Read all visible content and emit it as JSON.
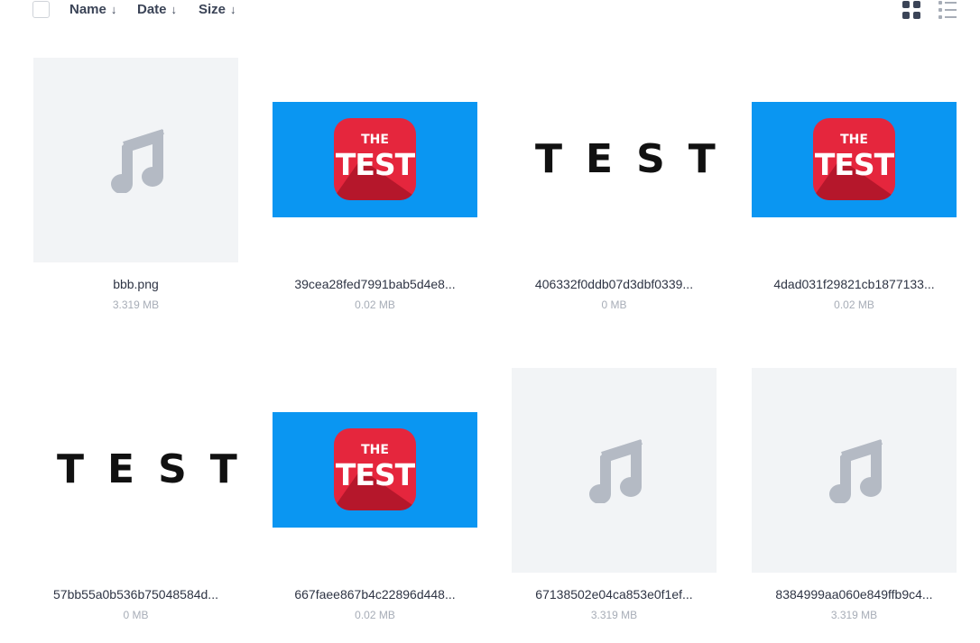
{
  "toolbar": {
    "sort_name": "Name",
    "sort_date": "Date",
    "sort_size": "Size",
    "arrow": "↓",
    "view_grid_icon": "grid-view-icon",
    "view_list_icon": "list-view-icon"
  },
  "colors": {
    "text_dark": "#2e3444",
    "text_muted": "#a7adb7",
    "placeholder_bg": "#f2f4f6",
    "music_icon": "#b4bac4",
    "thumb_blue": "#0a96f2",
    "logo_red": "#e5263d"
  },
  "files": [
    {
      "name": "bbb.png",
      "size": "3.319 MB",
      "thumb": "music"
    },
    {
      "name": "39cea28fed7991bab5d4e8...",
      "size": "0.02 MB",
      "thumb": "test-logo",
      "logo_top": "THE",
      "logo_bottom": "TEST"
    },
    {
      "name": "406332f0ddb07d3dbf0339...",
      "size": "0 MB",
      "thumb": "test-word",
      "word": "TEST"
    },
    {
      "name": "4dad031f29821cb1877133...",
      "size": "0.02 MB",
      "thumb": "test-logo",
      "logo_top": "THE",
      "logo_bottom": "TEST"
    },
    {
      "name": "57bb55a0b536b75048584d...",
      "size": "0 MB",
      "thumb": "test-word",
      "word": "TEST"
    },
    {
      "name": "667faee867b4c22896d448...",
      "size": "0.02 MB",
      "thumb": "test-logo",
      "logo_top": "THE",
      "logo_bottom": "TEST"
    },
    {
      "name": "67138502e04ca853e0f1ef...",
      "size": "3.319 MB",
      "thumb": "music"
    },
    {
      "name": "8384999aa060e849ffb9c4...",
      "size": "3.319 MB",
      "thumb": "music"
    }
  ]
}
